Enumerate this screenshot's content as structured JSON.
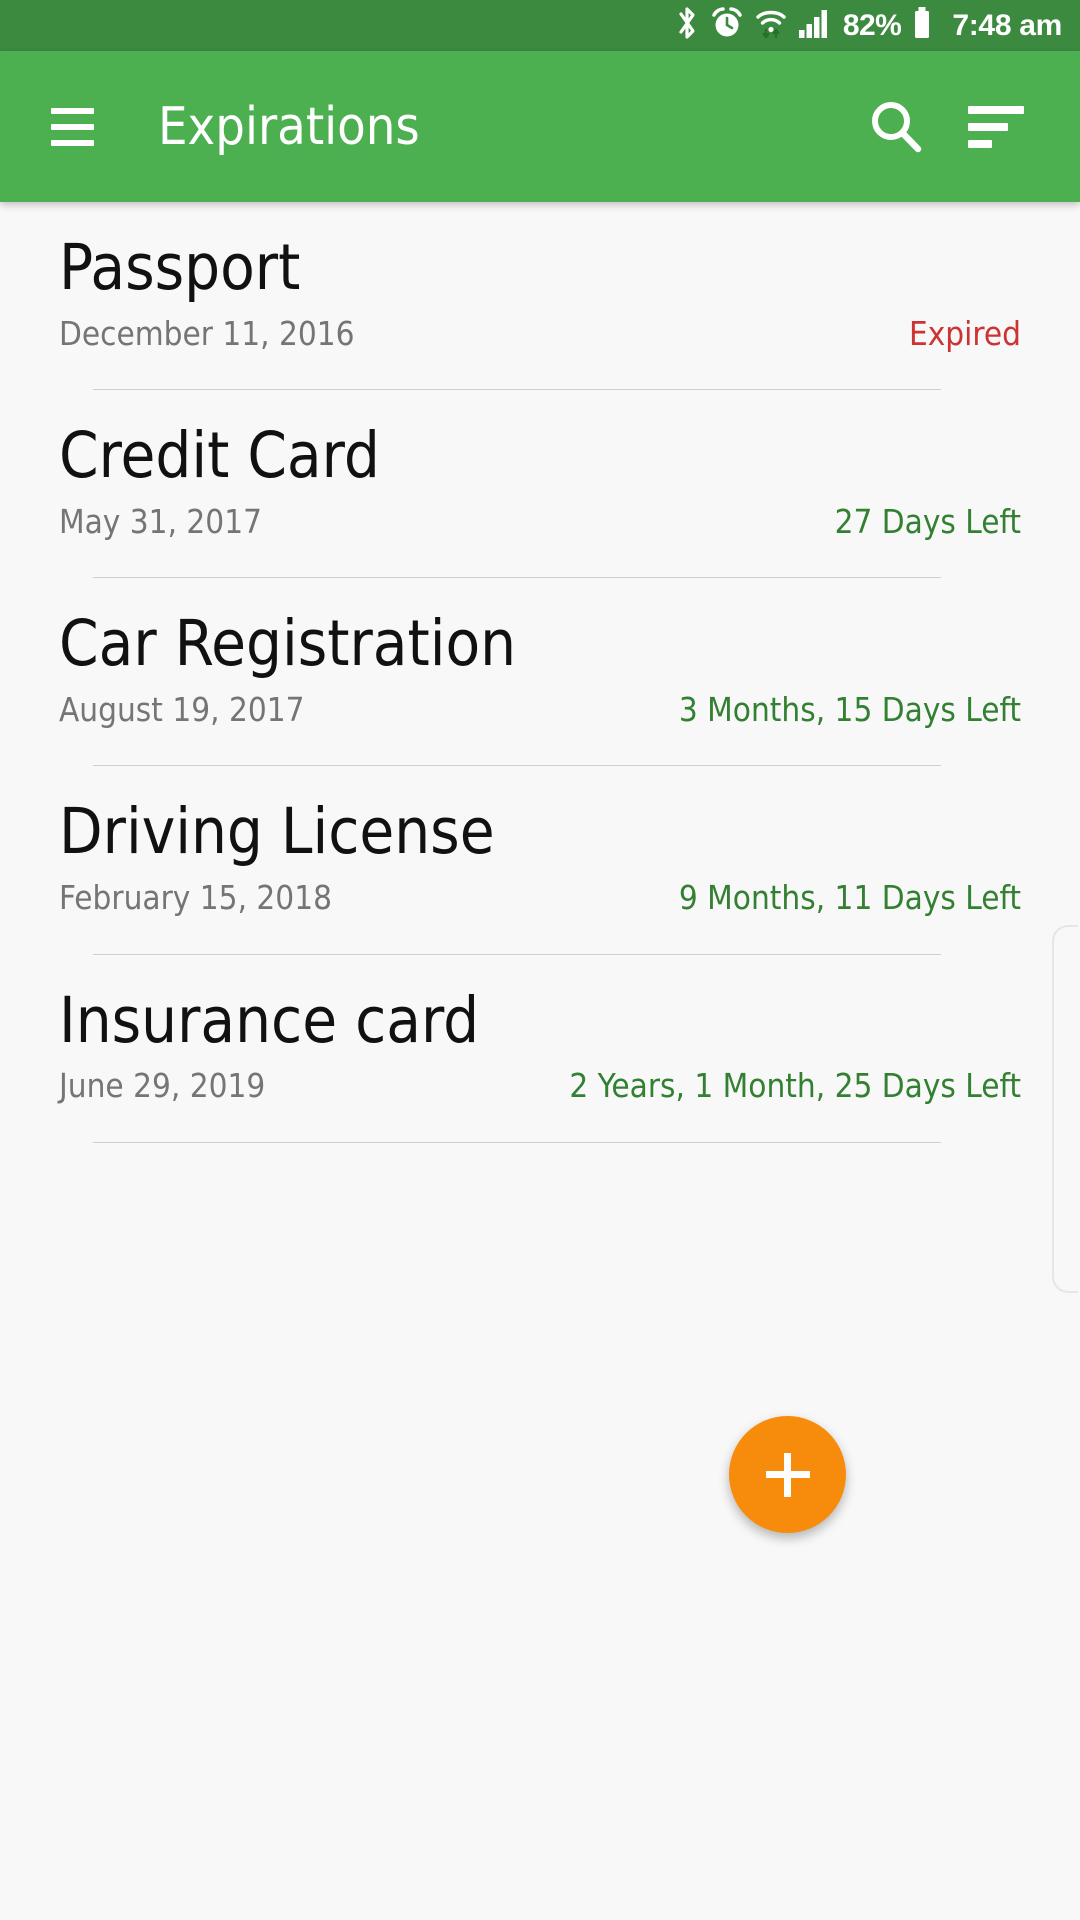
{
  "status_bar": {
    "icons": [
      "bluetooth-icon",
      "alarm-icon",
      "wifi-icon",
      "signal-icon",
      "battery-icon"
    ],
    "battery_percent": "82%",
    "time": "7:48 am",
    "background_color": "#3c8a3f",
    "foreground_color": "#ffffff"
  },
  "app_bar": {
    "menu_icon": "hamburger-menu-icon",
    "title": "Expirations",
    "search_icon": "search-icon",
    "sort_icon": "sort-icon",
    "background_color": "#4caf50",
    "foreground_color": "#ffffff"
  },
  "colors": {
    "accent_green": "#4caf50",
    "status_ok": "#338033",
    "status_expired": "#cc3333",
    "fab_orange": "#f78c0c",
    "page_background": "#f8f8f8",
    "divider": "#cfcfcf",
    "title_text": "#111111",
    "date_text": "#757575"
  },
  "list": {
    "items": [
      {
        "title": "Passport",
        "date": "December 11, 2016",
        "status": "Expired",
        "status_state": "expired"
      },
      {
        "title": "Credit Card",
        "date": "May 31, 2017",
        "status": "27 Days Left",
        "status_state": "ok"
      },
      {
        "title": "Car Registration",
        "date": "August 19, 2017",
        "status": "3 Months, 15 Days Left",
        "status_state": "ok"
      },
      {
        "title": "Driving License",
        "date": "February 15, 2018",
        "status": "9 Months, 11 Days Left",
        "status_state": "ok"
      },
      {
        "title": "Insurance card",
        "date": "June 29, 2019",
        "status": "2 Years, 1 Month, 25 Days Left",
        "status_state": "ok"
      }
    ]
  },
  "fab": {
    "icon": "plus-icon",
    "color": "#f78c0c"
  },
  "scrollbar": {
    "visible": true
  }
}
